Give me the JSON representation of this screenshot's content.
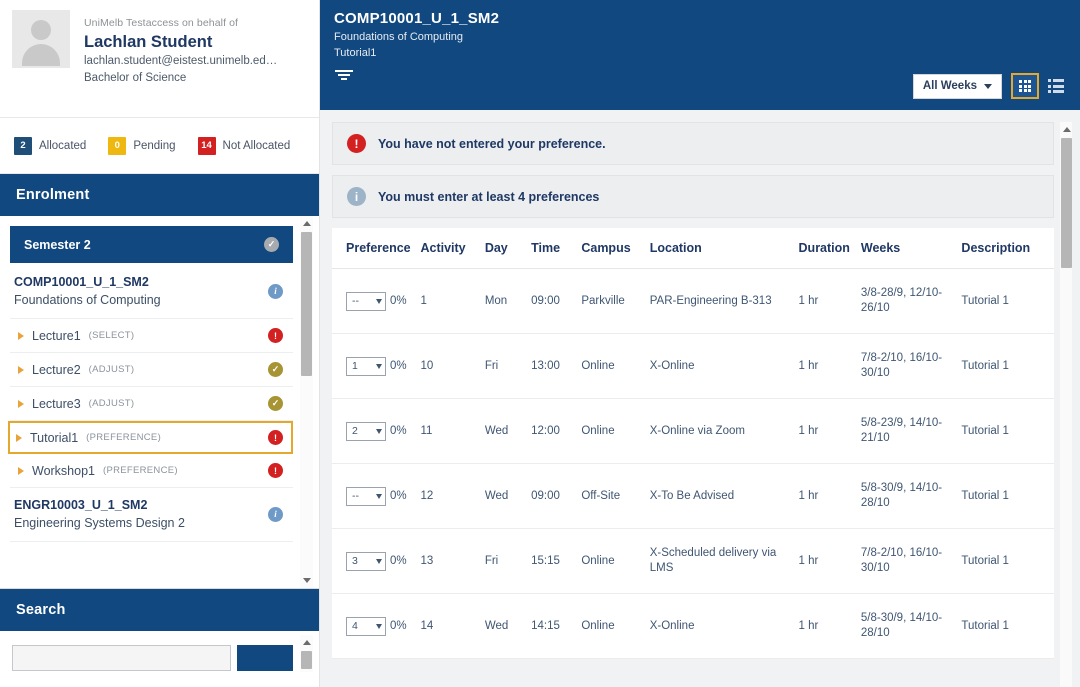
{
  "sidebar": {
    "profile": {
      "on_behalf": "UniMelb Testaccess on behalf of",
      "name": "Lachlan Student",
      "email": "lachlan.student@eistest.unimelb.ed…",
      "course": "Bachelor of Science"
    },
    "status": [
      {
        "count": "2",
        "label": "Allocated",
        "color": "#1f4e79"
      },
      {
        "count": "0",
        "label": "Pending",
        "color": "#efb810"
      },
      {
        "count": "14",
        "label": "Not Allocated",
        "color": "#d32020"
      }
    ],
    "enrolment": {
      "title": "Enrolment",
      "semester": {
        "label": "Semester 2",
        "icon": "check-circle-icon"
      },
      "courses": [
        {
          "code": "COMP10001_U_1_SM2",
          "name": "Foundations of Computing",
          "icon": "info-icon",
          "activities": [
            {
              "name": "Lecture1",
              "mode": "(SELECT)",
              "status": "alert",
              "selected": false
            },
            {
              "name": "Lecture2",
              "mode": "(ADJUST)",
              "status": "check",
              "selected": false
            },
            {
              "name": "Lecture3",
              "mode": "(ADJUST)",
              "status": "check",
              "selected": false
            },
            {
              "name": "Tutorial1",
              "mode": "(PREFERENCE)",
              "status": "alert",
              "selected": true
            },
            {
              "name": "Workshop1",
              "mode": "(PREFERENCE)",
              "status": "alert",
              "selected": false
            }
          ]
        },
        {
          "code": "ENGR10003_U_1_SM2",
          "name": "Engineering Systems Design 2",
          "icon": "info-icon",
          "activities": []
        }
      ]
    },
    "search": {
      "title": "Search",
      "placeholder": "",
      "value": "",
      "button_label": ""
    }
  },
  "main": {
    "header": {
      "title": "COMP10001_U_1_SM2",
      "subtitle": "Foundations of Computing",
      "activity": "Tutorial1",
      "filter_icon": "filter-icon",
      "weeks_selected": "All Weeks",
      "grid_view_icon": "grid-view-icon",
      "list_view_icon": "list-view-icon"
    },
    "alerts": [
      {
        "type": "error",
        "icon": "exclamation-circle-icon",
        "text": "You have not entered your preference."
      },
      {
        "type": "info",
        "icon": "info-circle-icon",
        "text": "You must enter at least 4 preferences"
      }
    ],
    "table": {
      "columns": [
        "Preference",
        "Activity",
        "Day",
        "Time",
        "Campus",
        "Location",
        "Duration",
        "Weeks",
        "Description"
      ],
      "rows": [
        {
          "preference": "--",
          "percent": "0%",
          "activity": "1",
          "day": "Mon",
          "time": "09:00",
          "campus": "Parkville",
          "location": "PAR-Engineering B-313",
          "duration": "1 hr",
          "weeks": "3/8-28/9, 12/10-26/10",
          "description": "Tutorial 1"
        },
        {
          "preference": "1",
          "percent": "0%",
          "activity": "10",
          "day": "Fri",
          "time": "13:00",
          "campus": "Online",
          "location": "X-Online",
          "duration": "1 hr",
          "weeks": "7/8-2/10, 16/10-30/10",
          "description": "Tutorial 1"
        },
        {
          "preference": "2",
          "percent": "0%",
          "activity": "11",
          "day": "Wed",
          "time": "12:00",
          "campus": "Online",
          "location": "X-Online via Zoom",
          "duration": "1 hr",
          "weeks": "5/8-23/9, 14/10-21/10",
          "description": "Tutorial 1"
        },
        {
          "preference": "--",
          "percent": "0%",
          "activity": "12",
          "day": "Wed",
          "time": "09:00",
          "campus": "Off-Site",
          "location": "X-To Be Advised",
          "duration": "1 hr",
          "weeks": "5/8-30/9, 14/10-28/10",
          "description": "Tutorial 1"
        },
        {
          "preference": "3",
          "percent": "0%",
          "activity": "13",
          "day": "Fri",
          "time": "15:15",
          "campus": "Online",
          "location": "X-Scheduled delivery via LMS",
          "duration": "1 hr",
          "weeks": "7/8-2/10, 16/10-30/10",
          "description": "Tutorial 1"
        },
        {
          "preference": "4",
          "percent": "0%",
          "activity": "14",
          "day": "Wed",
          "time": "14:15",
          "campus": "Online",
          "location": "X-Online",
          "duration": "1 hr",
          "weeks": "5/8-30/9, 14/10-28/10",
          "description": "Tutorial 1"
        }
      ]
    }
  },
  "theme": {
    "brand_blue": "#11487f",
    "accent_gold": "#e5a82e",
    "error_red": "#d32020",
    "text_navy": "#1f3864"
  }
}
